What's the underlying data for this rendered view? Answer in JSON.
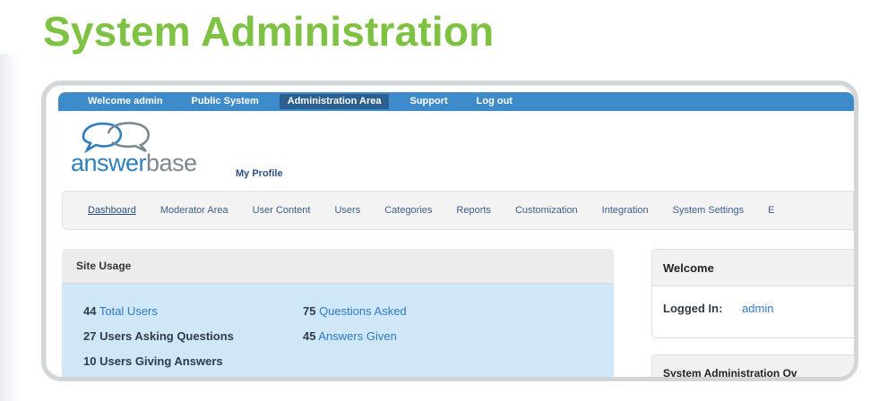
{
  "page": {
    "heading": "System Administration"
  },
  "topbar": {
    "items": [
      {
        "label": "Welcome admin"
      },
      {
        "label": "Public System"
      },
      {
        "label": "Administration Area",
        "active": true
      },
      {
        "label": "Support"
      },
      {
        "label": "Log out"
      }
    ]
  },
  "brand": {
    "logo_part1": "answer",
    "logo_part2": "base",
    "my_profile": "My Profile"
  },
  "nav": {
    "items": [
      {
        "label": "Dashboard",
        "active": true
      },
      {
        "label": "Moderator Area"
      },
      {
        "label": "User Content"
      },
      {
        "label": "Users"
      },
      {
        "label": "Categories"
      },
      {
        "label": "Reports"
      },
      {
        "label": "Customization"
      },
      {
        "label": "Integration"
      },
      {
        "label": "System Settings"
      },
      {
        "label": "E"
      }
    ]
  },
  "site_usage": {
    "title": "Site Usage",
    "stats": [
      {
        "num": "44",
        "label": "Total Users"
      },
      {
        "num": "75",
        "label": "Questions Asked"
      },
      {
        "num": "27",
        "label": "Users Asking Questions"
      },
      {
        "num": "45",
        "label": "Answers Given"
      },
      {
        "num": "10",
        "label": "Users Giving Answers"
      }
    ]
  },
  "welcome": {
    "title": "Welcome",
    "logged_in_label": "Logged In:",
    "logged_in_user": "admin"
  },
  "sys_overview": {
    "title": "System Administration Ov"
  },
  "colors": {
    "heading_green": "#7dc242",
    "topbar_blue": "#3d8bcb",
    "link_blue": "#2f79c4",
    "usage_bg": "#cfe7f6"
  },
  "icons": {
    "logo": "speech-bubbles-logo-icon"
  }
}
